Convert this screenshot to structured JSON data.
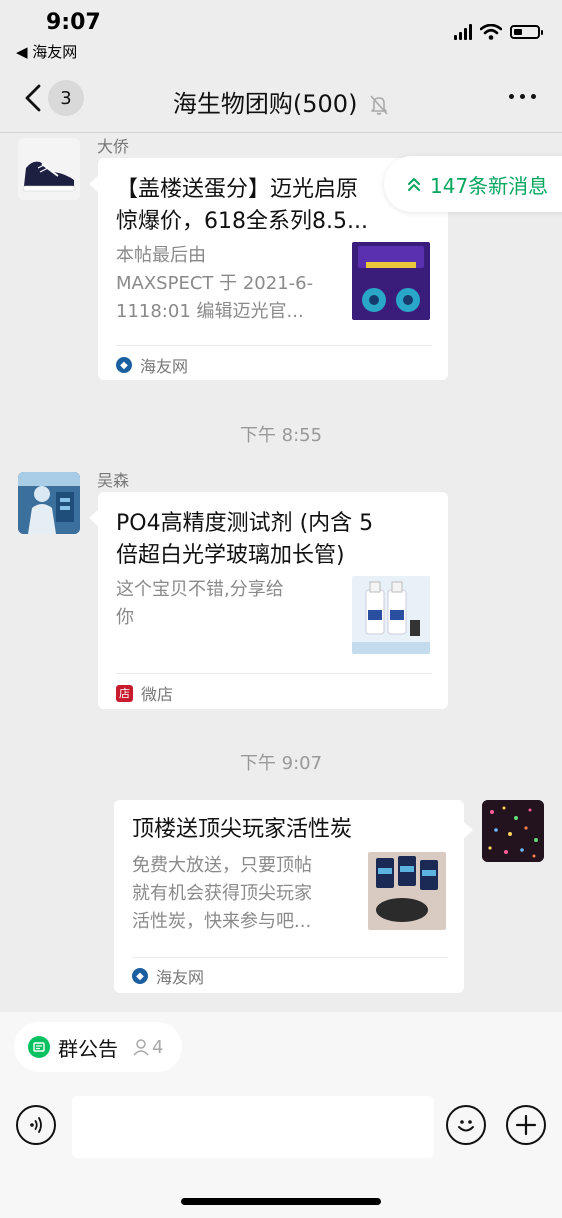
{
  "status_bar": {
    "time": "9:07",
    "back_app": "◀ 海友网"
  },
  "nav": {
    "unread_count": "3",
    "title": "海生物团购(500)"
  },
  "new_messages": {
    "label": "147条新消息"
  },
  "messages": [
    {
      "sender": "大侨",
      "card": {
        "title_line1": "【盖楼送蛋分】迈光启原",
        "title_line2": "惊爆价，618全系列8.5...",
        "desc_line1": "本帖最后由",
        "desc_line2": "MAXSPECT 于 2021-6-",
        "desc_line3": "1118:01 编辑迈光官...",
        "source": "海友网"
      }
    },
    {
      "time": "下午 8:55"
    },
    {
      "sender": "吴森",
      "card": {
        "title_line1": "PO4高精度测试剂 (内含 5",
        "title_line2": "倍超白光学玻璃加长管)",
        "desc_line1": "这个宝贝不错,分享给",
        "desc_line2": "你",
        "source": "微店"
      }
    },
    {
      "time": "下午 9:07"
    },
    {
      "card": {
        "title_line1": "顶楼送顶尖玩家活性炭",
        "desc_line1": "免费大放送，只要顶帖",
        "desc_line2": "就有机会获得顶尖玩家",
        "desc_line3": "活性炭，快来参与吧...",
        "source": "海友网"
      }
    }
  ],
  "bottom": {
    "notice_label": "群公告",
    "notice_count": "4",
    "input_placeholder": ""
  },
  "colors": {
    "accent_green": "#07c160",
    "new_msg_green": "#07a760",
    "background": "#ededed"
  }
}
